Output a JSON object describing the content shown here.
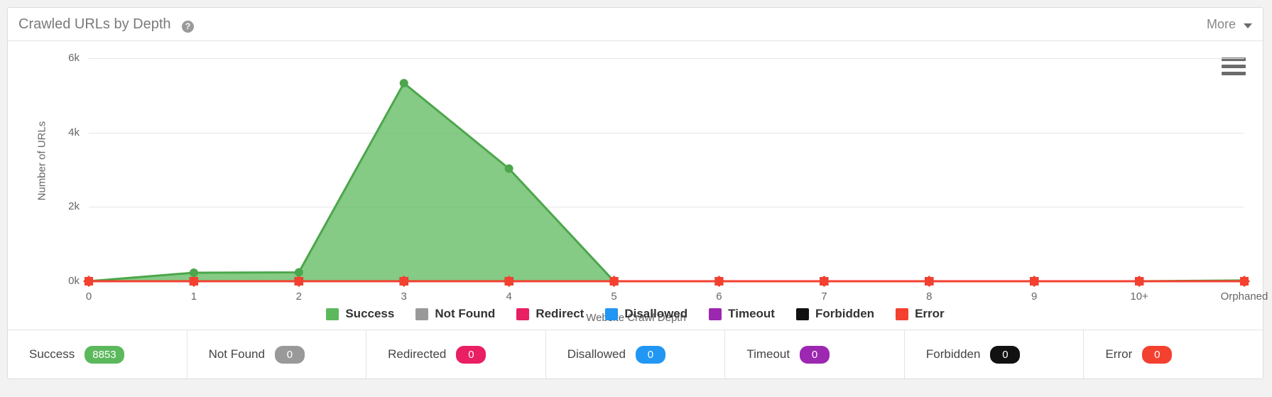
{
  "header": {
    "title": "Crawled URLs by Depth",
    "help_icon": "question-mark-icon",
    "more_label": "More",
    "caret_icon": "chevron-down-icon"
  },
  "chart_menu": {
    "icon": "hamburger-menu-icon"
  },
  "colors": {
    "success": "#5cb85c",
    "success_line": "#4ca64c",
    "not_found": "#999999",
    "redirect": "#e91e63",
    "disallowed": "#2196f3",
    "timeout": "#9c27b0",
    "forbidden": "#111111",
    "error": "#f4402f",
    "grid": "#e6e6e6",
    "axis_text": "#666666"
  },
  "chart_data": {
    "type": "area",
    "title": "Crawled URLs by Depth",
    "xlabel": "Website Crawl Depth",
    "ylabel": "Number of URLs",
    "categories": [
      "0",
      "1",
      "2",
      "3",
      "4",
      "5",
      "6",
      "7",
      "8",
      "9",
      "10+",
      "Orphaned"
    ],
    "ytick_labels": [
      "0k",
      "2k",
      "4k",
      "6k"
    ],
    "ytick_values": [
      0,
      2000,
      4000,
      6000
    ],
    "ylim": [
      0,
      6000
    ],
    "grid": true,
    "legend_position": "bottom",
    "series": [
      {
        "name": "Success",
        "color": "#5cb85c",
        "values": [
          1,
          230,
          240,
          5330,
          3030,
          0,
          0,
          0,
          0,
          0,
          0,
          22
        ]
      },
      {
        "name": "Not Found",
        "color": "#999999",
        "values": [
          0,
          0,
          0,
          0,
          0,
          0,
          0,
          0,
          0,
          0,
          0,
          0
        ]
      },
      {
        "name": "Redirect",
        "color": "#e91e63",
        "values": [
          0,
          0,
          0,
          0,
          0,
          0,
          0,
          0,
          0,
          0,
          0,
          0
        ]
      },
      {
        "name": "Disallowed",
        "color": "#2196f3",
        "values": [
          0,
          0,
          0,
          0,
          0,
          0,
          0,
          0,
          0,
          0,
          0,
          0
        ]
      },
      {
        "name": "Timeout",
        "color": "#9c27b0",
        "values": [
          0,
          0,
          0,
          0,
          0,
          0,
          0,
          0,
          0,
          0,
          0,
          0
        ]
      },
      {
        "name": "Forbidden",
        "color": "#111111",
        "values": [
          0,
          0,
          0,
          0,
          0,
          0,
          0,
          0,
          0,
          0,
          0,
          0
        ]
      },
      {
        "name": "Error",
        "color": "#f4402f",
        "values": [
          0,
          0,
          0,
          0,
          0,
          0,
          0,
          0,
          0,
          0,
          0,
          0
        ]
      }
    ]
  },
  "legend": [
    {
      "label": "Success",
      "color": "#5cb85c"
    },
    {
      "label": "Not Found",
      "color": "#999999"
    },
    {
      "label": "Redirect",
      "color": "#e91e63"
    },
    {
      "label": "Disallowed",
      "color": "#2196f3"
    },
    {
      "label": "Timeout",
      "color": "#9c27b0"
    },
    {
      "label": "Forbidden",
      "color": "#111111"
    },
    {
      "label": "Error",
      "color": "#f4402f"
    }
  ],
  "stats": [
    {
      "label": "Success",
      "value": "8853",
      "color": "#5cb85c"
    },
    {
      "label": "Not Found",
      "value": "0",
      "color": "#999999"
    },
    {
      "label": "Redirected",
      "value": "0",
      "color": "#e91e63"
    },
    {
      "label": "Disallowed",
      "value": "0",
      "color": "#2196f3"
    },
    {
      "label": "Timeout",
      "value": "0",
      "color": "#9c27b0"
    },
    {
      "label": "Forbidden",
      "value": "0",
      "color": "#111111"
    },
    {
      "label": "Error",
      "value": "0",
      "color": "#f4402f"
    }
  ]
}
